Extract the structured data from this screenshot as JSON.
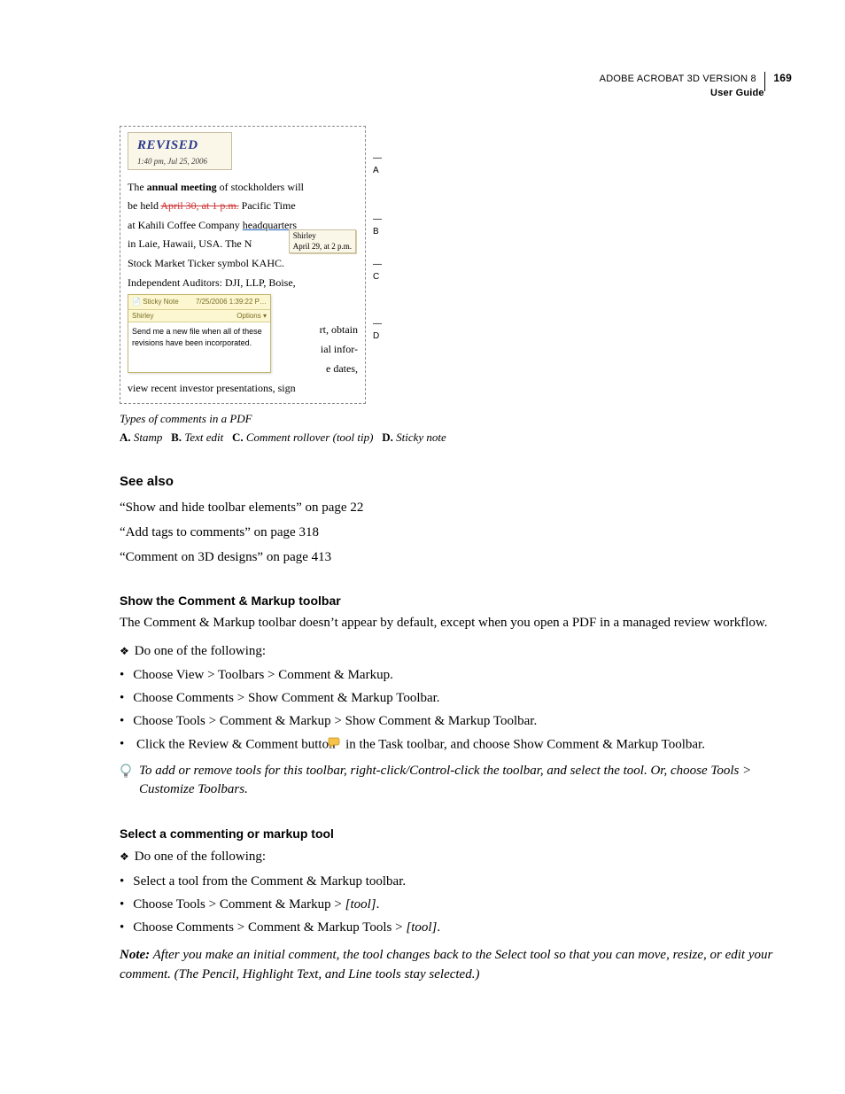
{
  "header": {
    "product": "ADOBE ACROBAT 3D VERSION 8",
    "doc": "User Guide",
    "page": "169"
  },
  "figure": {
    "stamp": {
      "title": "REVISED",
      "datetime": "1:40 pm, Jul 25, 2006"
    },
    "para1_a": "The ",
    "para1_bold": "annual meeting",
    "para1_b": " of stockholders will",
    "para2_a": "be held ",
    "para2_strike": "April 30, at 1 p.m.",
    "para2_b": " Pacific Time",
    "para3_a": "at Kahili Coffee Company ",
    "para3_u": "headquarters",
    "para4": "in Laie, Hawaii, USA. The N",
    "para5": "Stock Market Ticker symbol KAHC.",
    "para6": "Independent Auditors: DJI, LLP, Boise,",
    "tooltip_author": "Shirley",
    "tooltip_text": "April 29, at 2 p.m.",
    "sticky": {
      "icon_label": "Sticky Note",
      "timestamp": "7/25/2006 1:39:22 P…",
      "author": "Shirley",
      "options": "Options ▾",
      "body": "Send me a new file when all of these revisions have been incorporated."
    },
    "frag1": "rt, obtain",
    "frag2": "ial infor-",
    "frag3": "e dates,",
    "last": "view recent investor presentations, sign",
    "labels": {
      "a": "A",
      "b": "B",
      "c": "C",
      "d": "D"
    }
  },
  "caption": "Types of comments in a PDF",
  "legend": {
    "a_key": "A.",
    "a_val": "Stamp",
    "b_key": "B.",
    "b_val": "Text edit",
    "c_key": "C.",
    "c_val": "Comment rollover (tool tip)",
    "d_key": "D.",
    "d_val": "Sticky note"
  },
  "seealso": {
    "heading": "See also",
    "items": [
      "“Show and hide toolbar elements” on page 22",
      "“Add tags to comments” on page 318",
      "“Comment on 3D designs” on page 413"
    ]
  },
  "sec1": {
    "heading": "Show the Comment & Markup toolbar",
    "intro": "The Comment & Markup toolbar doesn’t appear by default, except when you open a PDF in a managed review workflow.",
    "do": "Do one of the following:",
    "b1": "Choose View > Toolbars > Comment & Markup.",
    "b2": "Choose Comments > Show Comment & Markup Toolbar.",
    "b3": "Choose Tools > Comment & Markup > Show Comment & Markup Toolbar.",
    "b4a": "Click the Review & Comment button ",
    "b4b": " in the Task toolbar, and choose Show Comment & Markup Toolbar.",
    "tip": "To add or remove tools for this toolbar, right-click/Control-click the toolbar, and select the tool. Or, choose Tools > Customize Toolbars."
  },
  "sec2": {
    "heading": "Select a commenting or markup tool",
    "do": "Do one of the following:",
    "b1": "Select a tool from the Comment & Markup toolbar.",
    "b2a": "Choose Tools > Comment & Markup > ",
    "b2b": "[tool]",
    "b2c": ".",
    "b3a": "Choose Comments > Comment & Markup Tools > ",
    "b3b": "[tool]",
    "b3c": ".",
    "note_label": "Note:",
    "note_body": " After you make an initial comment, the tool changes back to the Select tool so that you can move, resize, or edit your comment. (The Pencil, Highlight Text, and Line tools stay selected.)"
  }
}
